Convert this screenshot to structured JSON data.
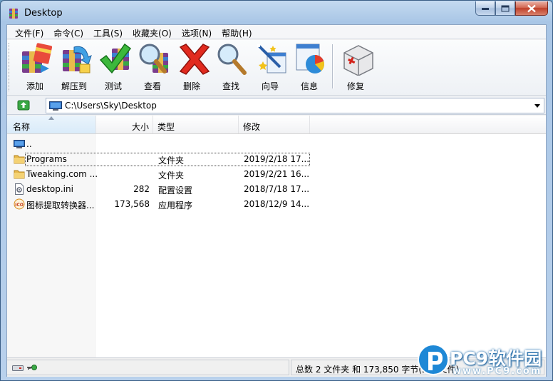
{
  "window": {
    "title": "Desktop"
  },
  "menu": [
    {
      "label": "文件(F)"
    },
    {
      "label": "命令(C)"
    },
    {
      "label": "工具(S)"
    },
    {
      "label": "收藏夹(O)"
    },
    {
      "label": "选项(N)"
    },
    {
      "label": "帮助(H)"
    }
  ],
  "toolbar": {
    "buttons": [
      {
        "label": "添加",
        "icon": "add-archive-icon"
      },
      {
        "label": "解压到",
        "icon": "extract-icon"
      },
      {
        "label": "测试",
        "icon": "test-checkmark-icon"
      },
      {
        "label": "查看",
        "icon": "view-magnifier-icon"
      },
      {
        "label": "删除",
        "icon": "delete-x-icon"
      },
      {
        "label": "查找",
        "icon": "find-magnifier-icon"
      },
      {
        "label": "向导",
        "icon": "wizard-wand-icon"
      },
      {
        "label": "信息",
        "icon": "info-pie-chart-icon"
      },
      {
        "label": "修复",
        "icon": "repair-first-aid-icon"
      }
    ]
  },
  "address": {
    "path": "C:\\Users\\Sky\\Desktop"
  },
  "columns": {
    "name": "名称",
    "size": "大小",
    "type": "类型",
    "modified": "修改"
  },
  "files": [
    {
      "name": "..",
      "size": "",
      "type": "",
      "modified": "",
      "icon": "parent-folder-icon"
    },
    {
      "name": "Programs",
      "size": "",
      "type": "文件夹",
      "modified": "2019/2/18 17...",
      "icon": "folder-icon"
    },
    {
      "name": "Tweaking.com ...",
      "size": "",
      "type": "文件夹",
      "modified": "2019/2/21 16...",
      "icon": "folder-icon"
    },
    {
      "name": "desktop.ini",
      "size": "282",
      "type": "配置设置",
      "modified": "2018/7/18 17...",
      "icon": "settings-file-icon"
    },
    {
      "name": "图标提取转换器...",
      "size": "173,568",
      "type": "应用程序",
      "modified": "2018/12/9 14...",
      "icon": "ico-app-icon"
    }
  ],
  "status": {
    "summary": "总数 2 文件夹 和 173,850 字节(2 个文件)"
  },
  "watermark": {
    "brand": "PC9软件园",
    "url": "www.PC9.com"
  },
  "colors": {
    "accent": "#1e6fb0",
    "close": "#c0402a"
  }
}
